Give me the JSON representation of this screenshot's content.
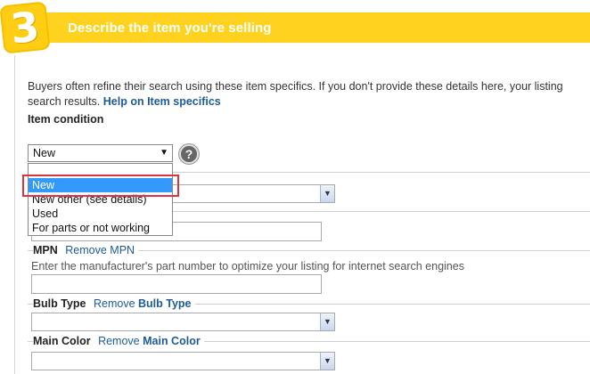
{
  "header": {
    "step_number": "3",
    "title": "Describe the item you're selling"
  },
  "intro": {
    "text": "Buyers often refine their search using these item specifics. If you don't provide these details here, your listing",
    "text2": "search results.",
    "link": "Help on Item specifics"
  },
  "condition": {
    "label": "Item condition",
    "selected": "New",
    "options": [
      "New",
      "New other (see details)",
      "Used",
      "For parts or not working"
    ]
  },
  "fields": {
    "mpn": {
      "label": "MPN",
      "remove_text": "Remove",
      "remove_name": "MPN",
      "description": "Enter the manufacturer's part number to optimize your listing for internet search engines"
    },
    "bulb_type": {
      "label": "Bulb Type",
      "remove_text": "Remove",
      "remove_name": "Bulb Type"
    },
    "main_color": {
      "label": "Main Color",
      "remove_text": "Remove",
      "remove_name": "Main Color"
    }
  },
  "colors": {
    "header_yellow": "#ffd21f",
    "link_blue": "#1d5b97",
    "selected_option": "#3399ff",
    "highlight_red": "#d9363e"
  }
}
